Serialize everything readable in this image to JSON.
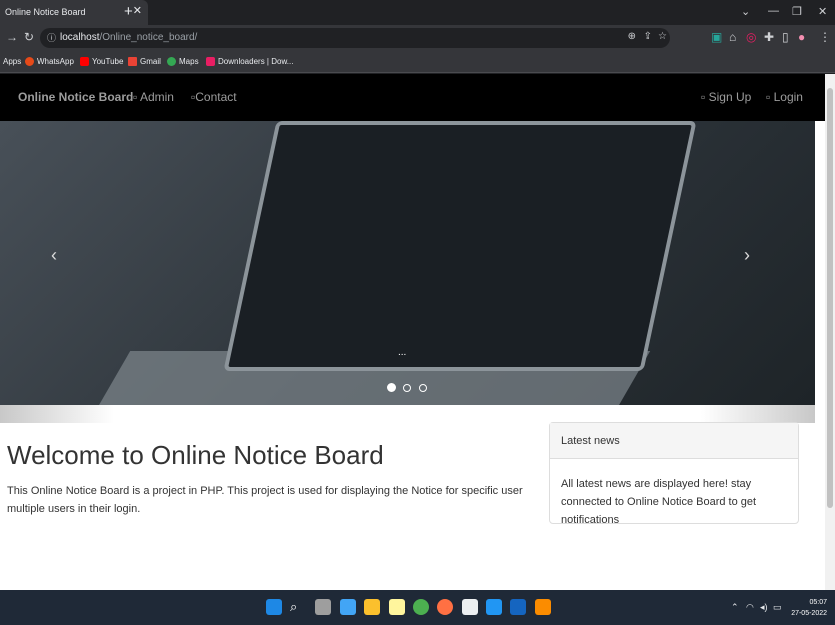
{
  "browser": {
    "tab_title": "Online Notice Board",
    "tab_close": "✕",
    "new_tab": "+",
    "url_host": "localhost",
    "url_path": "/Online_notice_board/",
    "bookmarks": [
      {
        "label": "Apps",
        "icon": "apps-grid-icon"
      },
      {
        "label": "WhatsApp",
        "icon": "whatsapp-icon",
        "color": "#e64a19"
      },
      {
        "label": "YouTube",
        "icon": "youtube-icon",
        "color": "#ff0000"
      },
      {
        "label": "Gmail",
        "icon": "gmail-icon",
        "color": "#ea4335"
      },
      {
        "label": "Maps",
        "icon": "maps-icon",
        "color": "#34a853"
      },
      {
        "label": "Downloaders | Dow...",
        "icon": "downloaders-icon",
        "color": "#e91e63"
      }
    ]
  },
  "navbar": {
    "brand": "Online Notice Board",
    "admin": "Admin",
    "contact": "Contact",
    "signup": "Sign Up",
    "login": "Login"
  },
  "carousel": {
    "caption": "...",
    "prev": "‹",
    "next": "›",
    "slides": 3,
    "active": 1
  },
  "main": {
    "title": "Welcome to Online Notice Board",
    "text": "This Online Notice Board is a project in PHP. This project is used for displaying the Notice for specific user multiple users in their login."
  },
  "news": {
    "heading": "Latest news",
    "body": "All latest news are displayed here! stay connected to Online Notice Board to get notifications"
  },
  "taskbar": {
    "time": "05:07",
    "date": "27-05-2022"
  },
  "colors": {
    "navbar_bg": "#000000",
    "taskbar_bg": "#1f2937",
    "accent": "#9d9d9d"
  }
}
